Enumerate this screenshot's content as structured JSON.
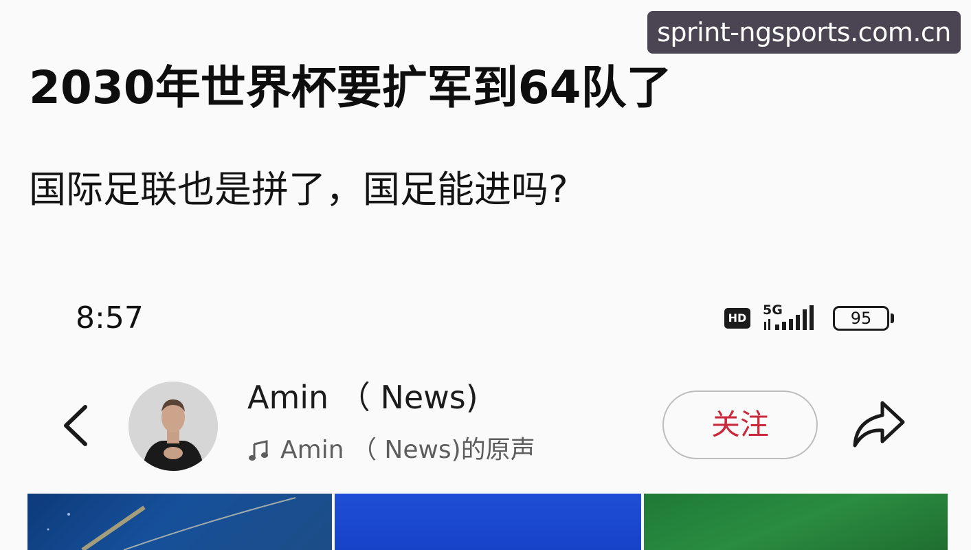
{
  "watermark": "sprint-ngsports.com.cn",
  "post": {
    "headline": "2030年世界杯要扩军到64队了",
    "subline": "国际足联也是拼了，国足能进吗?"
  },
  "status_bar": {
    "time": "8:57",
    "hd_label": "HD",
    "network_label": "5G",
    "battery_level": "95"
  },
  "profile_header": {
    "back_icon": "chevron-left-icon",
    "account_name": "Amin （ News)",
    "audio_label": "Amin （ News)的原声",
    "follow_label": "关注",
    "share_icon": "share-arrow-icon"
  },
  "colors": {
    "background": "#fbfafb",
    "follow_text": "#c82a3c",
    "watermark_bg": "#4b4453"
  }
}
